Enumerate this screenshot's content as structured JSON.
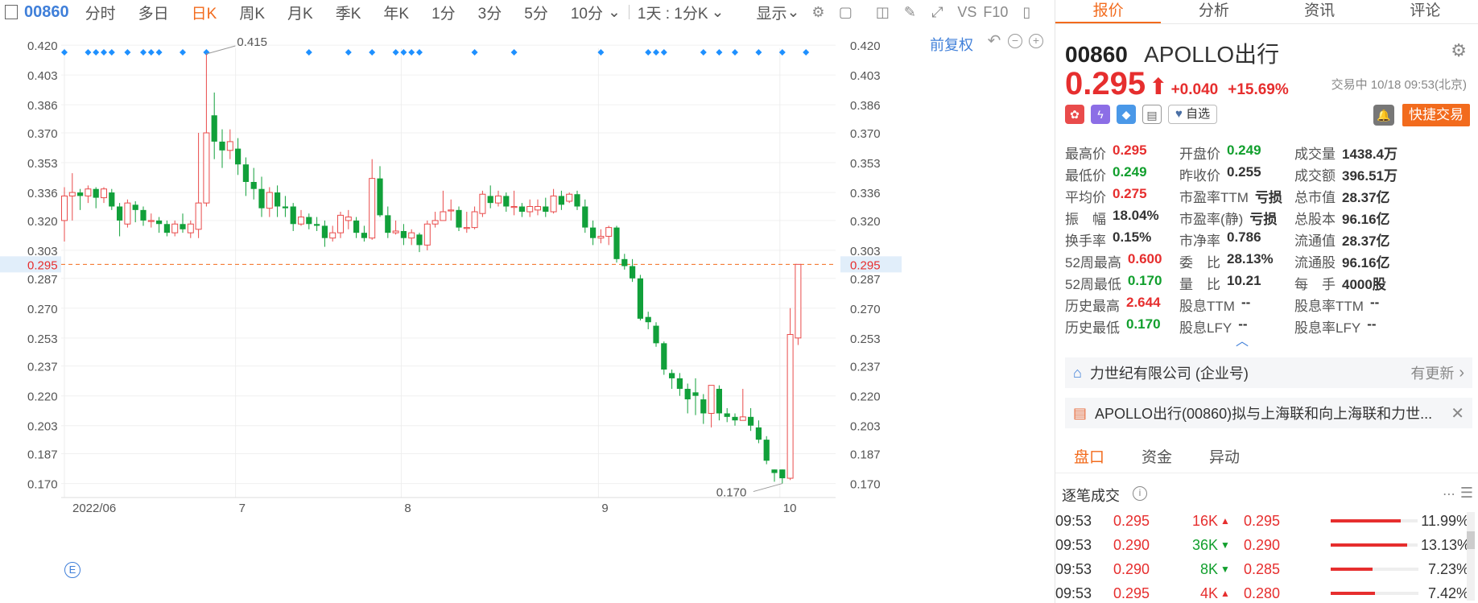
{
  "toolbar": {
    "code": "00860",
    "tabs": [
      "分时",
      "多日",
      "日K",
      "周K",
      "月K",
      "季K",
      "年K",
      "1分",
      "3分",
      "5分",
      "10分"
    ],
    "active_tab": "日K",
    "more_caret": "⌄",
    "interval_select": "1天 : 1分K",
    "display_label": "显示",
    "vs_label": "VS",
    "f10_label": "F10"
  },
  "chart": {
    "adjust_label": "前复权",
    "ctrl_undo": "↶",
    "ctrl_minus": "−",
    "ctrl_plus": "+",
    "e_marker": "E",
    "high_marker": "0.415",
    "low_marker": "0.170",
    "current_price_label": "0.295"
  },
  "chart_data": {
    "type": "candlestick",
    "ylim": [
      0.162,
      0.432
    ],
    "y_ticks": [
      "0.420",
      "0.403",
      "0.386",
      "0.370",
      "0.353",
      "0.336",
      "0.320",
      "0.303",
      "0.287",
      "0.270",
      "0.253",
      "0.237",
      "0.220",
      "0.203",
      "0.187",
      "0.170"
    ],
    "x_labels": [
      "2022/06",
      "7",
      "8",
      "9",
      "10"
    ],
    "x_label_index": [
      0,
      22,
      43,
      68,
      91
    ],
    "current_price": 0.295,
    "candles": [
      [
        0.32,
        0.334,
        0.339,
        0.308
      ],
      [
        0.334,
        0.336,
        0.347,
        0.32
      ],
      [
        0.336,
        0.334,
        0.338,
        0.326
      ],
      [
        0.334,
        0.338,
        0.34,
        0.33
      ],
      [
        0.338,
        0.333,
        0.339,
        0.327
      ],
      [
        0.333,
        0.338,
        0.339,
        0.33
      ],
      [
        0.336,
        0.328,
        0.338,
        0.326
      ],
      [
        0.328,
        0.32,
        0.33,
        0.311
      ],
      [
        0.318,
        0.33,
        0.332,
        0.316
      ],
      [
        0.329,
        0.326,
        0.331,
        0.319
      ],
      [
        0.326,
        0.32,
        0.328,
        0.317
      ],
      [
        0.32,
        0.32,
        0.324,
        0.316
      ],
      [
        0.32,
        0.318,
        0.322,
        0.313
      ],
      [
        0.318,
        0.313,
        0.32,
        0.311
      ],
      [
        0.313,
        0.318,
        0.32,
        0.311
      ],
      [
        0.318,
        0.315,
        0.324,
        0.313
      ],
      [
        0.313,
        0.318,
        0.32,
        0.31
      ],
      [
        0.315,
        0.33,
        0.37,
        0.31
      ],
      [
        0.33,
        0.37,
        0.415,
        0.328
      ],
      [
        0.38,
        0.365,
        0.393,
        0.355
      ],
      [
        0.365,
        0.36,
        0.372,
        0.35
      ],
      [
        0.36,
        0.365,
        0.372,
        0.355
      ],
      [
        0.361,
        0.352,
        0.367,
        0.346
      ],
      [
        0.352,
        0.342,
        0.356,
        0.334
      ],
      [
        0.342,
        0.338,
        0.35,
        0.332
      ],
      [
        0.338,
        0.327,
        0.345,
        0.322
      ],
      [
        0.327,
        0.336,
        0.339,
        0.322
      ],
      [
        0.336,
        0.328,
        0.34,
        0.322
      ],
      [
        0.328,
        0.327,
        0.334,
        0.322
      ],
      [
        0.328,
        0.318,
        0.33,
        0.314
      ],
      [
        0.318,
        0.322,
        0.326,
        0.317
      ],
      [
        0.322,
        0.318,
        0.324,
        0.315
      ],
      [
        0.318,
        0.317,
        0.322,
        0.314
      ],
      [
        0.317,
        0.31,
        0.32,
        0.305
      ],
      [
        0.31,
        0.313,
        0.317,
        0.308
      ],
      [
        0.313,
        0.323,
        0.325,
        0.31
      ],
      [
        0.32,
        0.322,
        0.326,
        0.315
      ],
      [
        0.32,
        0.313,
        0.322,
        0.31
      ],
      [
        0.313,
        0.31,
        0.317,
        0.308
      ],
      [
        0.31,
        0.344,
        0.355,
        0.309
      ],
      [
        0.344,
        0.323,
        0.351,
        0.322
      ],
      [
        0.323,
        0.313,
        0.328,
        0.31
      ],
      [
        0.313,
        0.314,
        0.32,
        0.312
      ],
      [
        0.314,
        0.31,
        0.318,
        0.306
      ],
      [
        0.31,
        0.313,
        0.315,
        0.306
      ],
      [
        0.312,
        0.306,
        0.313,
        0.302
      ],
      [
        0.306,
        0.318,
        0.32,
        0.303
      ],
      [
        0.318,
        0.32,
        0.325,
        0.316
      ],
      [
        0.32,
        0.325,
        0.337,
        0.32
      ],
      [
        0.326,
        0.326,
        0.332,
        0.32
      ],
      [
        0.326,
        0.316,
        0.328,
        0.314
      ],
      [
        0.316,
        0.316,
        0.325,
        0.313
      ],
      [
        0.316,
        0.325,
        0.328,
        0.315
      ],
      [
        0.324,
        0.335,
        0.337,
        0.322
      ],
      [
        0.334,
        0.33,
        0.34,
        0.327
      ],
      [
        0.33,
        0.334,
        0.337,
        0.328
      ],
      [
        0.334,
        0.328,
        0.336,
        0.325
      ],
      [
        0.328,
        0.328,
        0.337,
        0.323
      ],
      [
        0.328,
        0.325,
        0.33,
        0.322
      ],
      [
        0.325,
        0.328,
        0.332,
        0.322
      ],
      [
        0.326,
        0.328,
        0.332,
        0.323
      ],
      [
        0.328,
        0.325,
        0.333,
        0.322
      ],
      [
        0.325,
        0.334,
        0.338,
        0.324
      ],
      [
        0.334,
        0.329,
        0.337,
        0.326
      ],
      [
        0.331,
        0.335,
        0.336,
        0.33
      ],
      [
        0.335,
        0.328,
        0.337,
        0.326
      ],
      [
        0.328,
        0.316,
        0.332,
        0.313
      ],
      [
        0.316,
        0.31,
        0.32,
        0.306
      ],
      [
        0.31,
        0.311,
        0.315,
        0.307
      ],
      [
        0.311,
        0.316,
        0.317,
        0.306
      ],
      [
        0.316,
        0.298,
        0.317,
        0.296
      ],
      [
        0.298,
        0.294,
        0.301,
        0.292
      ],
      [
        0.294,
        0.287,
        0.298,
        0.285
      ],
      [
        0.287,
        0.264,
        0.289,
        0.263
      ],
      [
        0.265,
        0.262,
        0.268,
        0.258
      ],
      [
        0.26,
        0.25,
        0.262,
        0.248
      ],
      [
        0.25,
        0.235,
        0.251,
        0.232
      ],
      [
        0.233,
        0.23,
        0.235,
        0.224
      ],
      [
        0.23,
        0.224,
        0.233,
        0.22
      ],
      [
        0.224,
        0.218,
        0.227,
        0.21
      ],
      [
        0.222,
        0.22,
        0.23,
        0.209
      ],
      [
        0.218,
        0.21,
        0.221,
        0.204
      ],
      [
        0.21,
        0.226,
        0.225,
        0.202
      ],
      [
        0.224,
        0.21,
        0.226,
        0.206
      ],
      [
        0.21,
        0.208,
        0.213,
        0.205
      ],
      [
        0.208,
        0.206,
        0.21,
        0.203
      ],
      [
        0.206,
        0.208,
        0.224,
        0.206
      ],
      [
        0.208,
        0.203,
        0.213,
        0.2
      ],
      [
        0.202,
        0.195,
        0.206,
        0.193
      ],
      [
        0.195,
        0.183,
        0.197,
        0.181
      ],
      [
        0.178,
        0.176,
        0.178,
        0.171
      ],
      [
        0.178,
        0.173,
        0.178,
        0.17
      ],
      [
        0.173,
        0.255,
        0.27,
        0.172
      ],
      [
        0.253,
        0.295,
        0.295,
        0.249
      ]
    ]
  },
  "panel": {
    "tabs": [
      "报价",
      "分析",
      "资讯",
      "评论"
    ],
    "active_tab": "报价",
    "code": "00860",
    "name": "APOLLO出行",
    "price": "0.295",
    "price_arrow": "⬆",
    "change": "+0.040",
    "change_pct": "+15.69%",
    "status": "交易中 10/18 09:53(北京)",
    "watchlist_label": "自选",
    "quick_trade_label": "快捷交易",
    "badge_icons": [
      "hk-flag-icon",
      "lightning-icon",
      "tag-icon",
      "bookmark-icon"
    ],
    "quote_rows": [
      [
        [
          "最高价",
          "0.295",
          "red"
        ],
        [
          "开盘价",
          "0.249",
          "green"
        ],
        [
          "成交量",
          "1438.4万",
          ""
        ]
      ],
      [
        [
          "最低价",
          "0.249",
          "green"
        ],
        [
          "昨收价",
          "0.255",
          ""
        ],
        [
          "成交额",
          "396.51万",
          ""
        ]
      ],
      [
        [
          "平均价",
          "0.275",
          "red"
        ],
        [
          "市盈率TTM",
          "亏损",
          ""
        ],
        [
          "总市值",
          "28.37亿",
          ""
        ]
      ],
      [
        [
          "振　幅",
          "18.04%",
          ""
        ],
        [
          "市盈率(静)",
          "亏损",
          ""
        ],
        [
          "总股本",
          "96.16亿",
          ""
        ]
      ],
      [
        [
          "换手率",
          "0.15%",
          ""
        ],
        [
          "市净率",
          "0.786",
          ""
        ],
        [
          "流通值",
          "28.37亿",
          ""
        ]
      ],
      [
        [
          "52周最高",
          "0.600",
          "red"
        ],
        [
          "委　比",
          "28.13%",
          ""
        ],
        [
          "流通股",
          "96.16亿",
          ""
        ]
      ],
      [
        [
          "52周最低",
          "0.170",
          "green"
        ],
        [
          "量　比",
          "10.21",
          ""
        ],
        [
          "每　手",
          "4000股",
          ""
        ]
      ],
      [
        [
          "历史最高",
          "2.644",
          "red"
        ],
        [
          "股息TTM",
          "--",
          ""
        ],
        [
          "股息率TTM",
          "--",
          ""
        ]
      ],
      [
        [
          "历史最低",
          "0.170",
          "green"
        ],
        [
          "股息LFY",
          "--",
          ""
        ],
        [
          "股息率LFY",
          "--",
          ""
        ]
      ]
    ],
    "collapse_icon": "︿",
    "news": [
      {
        "text": "力世纪有限公司 (企业号)",
        "more": "有更新",
        "icon": "building-icon"
      },
      {
        "text": "APOLLO出行(00860)拟与上海联和向上海联和力世...",
        "icon": "document-icon"
      }
    ],
    "bottom_tabs": [
      "盘口",
      "资金",
      "异动"
    ],
    "active_bottom_tab": "盘口",
    "trades_title": "逐笔成交",
    "trades": [
      {
        "time": "09:53",
        "price": "0.295",
        "qty": "16K",
        "dir": "up"
      },
      {
        "time": "09:53",
        "price": "0.290",
        "qty": "36K",
        "dir": "dn"
      },
      {
        "time": "09:53",
        "price": "0.290",
        "qty": "8K",
        "dir": "dn"
      },
      {
        "time": "09:53",
        "price": "0.295",
        "qty": "4K",
        "dir": "up"
      }
    ],
    "distribution": [
      {
        "price": "0.295",
        "pct": "11.99%",
        "fill": 0.8
      },
      {
        "price": "0.290",
        "pct": "13.13%",
        "fill": 0.88
      },
      {
        "price": "0.285",
        "pct": "7.23%",
        "fill": 0.48
      },
      {
        "price": "0.280",
        "pct": "7.42%",
        "fill": 0.5
      }
    ]
  }
}
